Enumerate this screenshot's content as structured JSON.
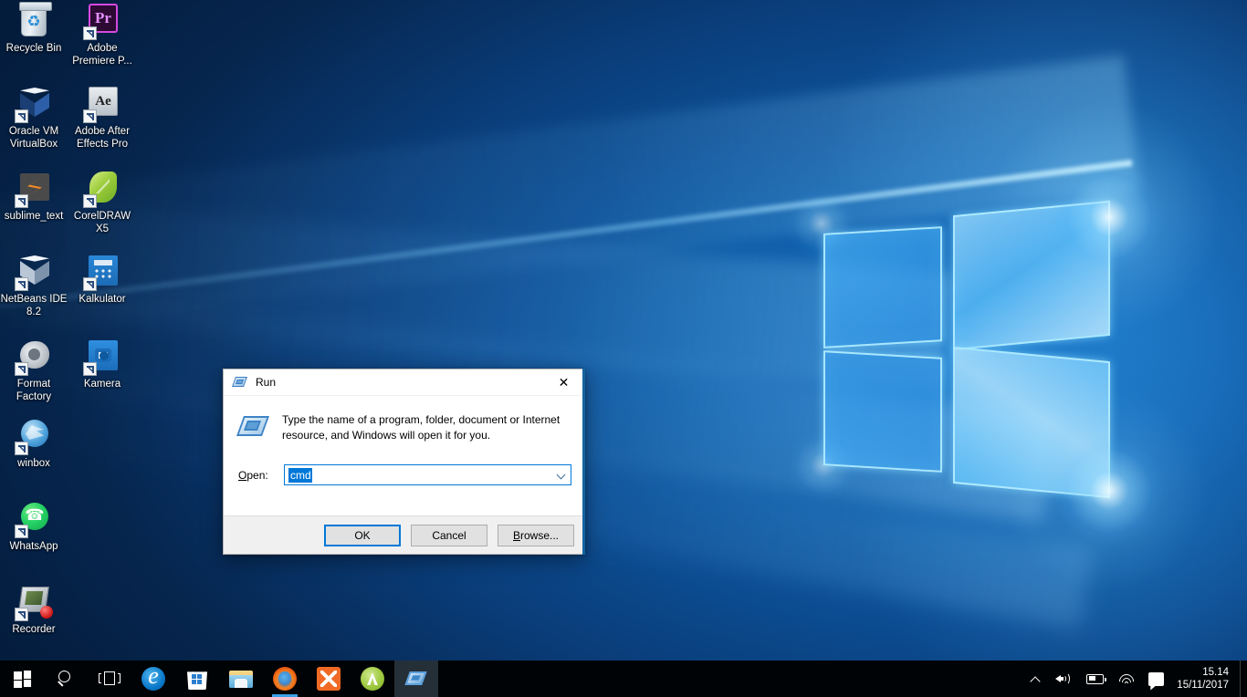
{
  "desktop": {
    "wallpaper_name": "windows-10-hero-wallpaper",
    "icons": [
      {
        "label": "Recycle Bin",
        "icon": "recycle-bin-icon",
        "shortcut": false
      },
      {
        "label": "Adobe Premiere P...",
        "icon": "adobe-premiere-pro-icon",
        "shortcut": true
      },
      {
        "label": "Oracle VM VirtualBox",
        "icon": "oracle-vm-virtualbox-icon",
        "shortcut": true
      },
      {
        "label": "Adobe After Effects Pro",
        "icon": "adobe-after-effects-icon",
        "shortcut": true
      },
      {
        "label": "sublime_text",
        "icon": "sublime-text-icon",
        "shortcut": true
      },
      {
        "label": "CorelDRAW X5",
        "icon": "coreldraw-icon",
        "shortcut": true
      },
      {
        "label": "NetBeans IDE 8.2",
        "icon": "netbeans-ide-icon",
        "shortcut": true
      },
      {
        "label": "Kalkulator",
        "icon": "calculator-icon",
        "shortcut": true
      },
      {
        "label": "Format Factory",
        "icon": "format-factory-icon",
        "shortcut": true
      },
      {
        "label": "Kamera",
        "icon": "camera-icon",
        "shortcut": true
      },
      {
        "label": "winbox",
        "icon": "winbox-icon",
        "shortcut": true
      },
      {
        "label": "WhatsApp",
        "icon": "whatsapp-icon",
        "shortcut": true
      },
      {
        "label": "Recorder",
        "icon": "recorder-icon",
        "shortcut": true
      }
    ]
  },
  "run_dialog": {
    "title": "Run",
    "title_icon": "run-window-icon",
    "close_label": "✕",
    "description": "Type the name of a program, folder, document or Internet resource, and Windows will open it for you.",
    "open_label_prefix": "",
    "open_label_accesskey": "O",
    "open_label_suffix": "pen:",
    "open_value": "cmd",
    "open_placeholder": "",
    "buttons": {
      "ok": "OK",
      "cancel": "Cancel",
      "browse_accesskey": "B",
      "browse_suffix": "rowse..."
    },
    "accent_color": "#0078d7",
    "selection_color": "#0078d7"
  },
  "taskbar": {
    "start_label": "Start",
    "items": [
      {
        "name": "start-button",
        "tooltip": "Start",
        "state": "idle"
      },
      {
        "name": "search-button",
        "tooltip": "Search",
        "state": "idle"
      },
      {
        "name": "task-view-button",
        "tooltip": "Task View",
        "state": "idle"
      },
      {
        "name": "taskbar-item-edge",
        "tooltip": "Microsoft Edge",
        "state": "idle"
      },
      {
        "name": "taskbar-item-store",
        "tooltip": "Store",
        "state": "idle"
      },
      {
        "name": "taskbar-item-file-explorer",
        "tooltip": "File Explorer",
        "state": "idle"
      },
      {
        "name": "taskbar-item-firefox",
        "tooltip": "Mozilla Firefox",
        "state": "running"
      },
      {
        "name": "taskbar-item-xampp",
        "tooltip": "XAMPP",
        "state": "idle"
      },
      {
        "name": "taskbar-item-android-studio",
        "tooltip": "Android Studio",
        "state": "idle"
      },
      {
        "name": "taskbar-item-run",
        "tooltip": "Run",
        "state": "active"
      }
    ],
    "tray": {
      "show_hidden_icons": "show-hidden-icons-chevron",
      "volume": "volume-icon",
      "battery": "battery-icon",
      "network": "wifi-icon",
      "action_center": "action-center-icon",
      "time": "15.14",
      "date": "15/11/2017"
    }
  }
}
